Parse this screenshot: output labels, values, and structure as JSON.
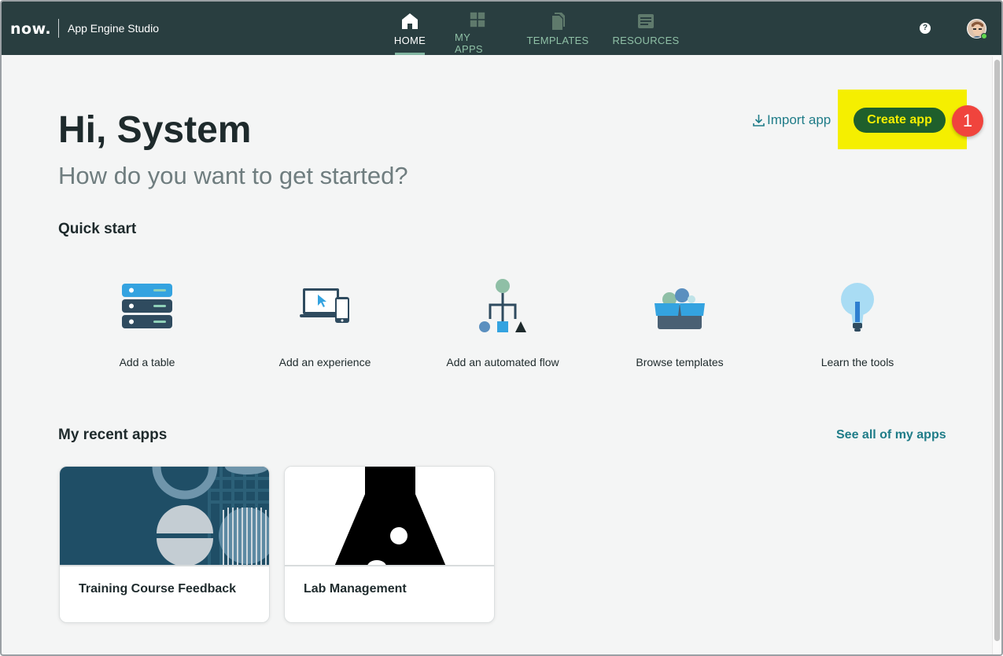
{
  "header": {
    "logo": "now.",
    "app_name": "App Engine Studio",
    "nav": [
      {
        "label": "HOME",
        "icon": "home-icon",
        "active": true
      },
      {
        "label": "MY APPS",
        "icon": "apps-grid-icon",
        "active": false
      },
      {
        "label": "TEMPLATES",
        "icon": "templates-icon",
        "active": false
      },
      {
        "label": "RESOURCES",
        "icon": "resources-icon",
        "active": false
      }
    ],
    "help_glyph": "?"
  },
  "main": {
    "greeting": "Hi, System",
    "subtitle": "How do you want to get started?",
    "import_label": "Import app",
    "create_label": "Create app",
    "step_badge": "1",
    "quick_start_title": "Quick start",
    "quick_start": [
      {
        "label": "Add a table",
        "icon": "table-icon"
      },
      {
        "label": "Add an experience",
        "icon": "experience-icon"
      },
      {
        "label": "Add an automated flow",
        "icon": "flow-icon"
      },
      {
        "label": "Browse templates",
        "icon": "templates-box-icon"
      },
      {
        "label": "Learn the tools",
        "icon": "lightbulb-icon"
      }
    ],
    "recent_title": "My recent apps",
    "see_all_label": "See all of my apps",
    "recent_apps": [
      {
        "name": "Training Course Feedback"
      },
      {
        "name": "Lab Management"
      }
    ]
  },
  "colors": {
    "header_bg": "#293e40",
    "accent_teal": "#1f7c88",
    "nav_inactive": "#8fc0a6",
    "create_btn_bg": "#1f5f2c",
    "highlight": "#f5ef00",
    "badge": "#f0443d"
  }
}
